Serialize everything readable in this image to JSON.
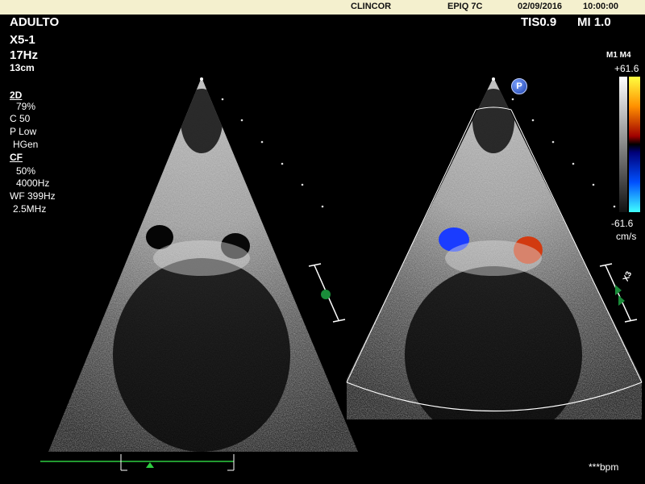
{
  "header": {
    "facility": "CLINCOR",
    "system": "EPIQ 7C",
    "date": "02/09/2016",
    "time": "10:00:00"
  },
  "exam": {
    "preset": "ADULTO",
    "probe": "X5-1",
    "frame_rate": "17Hz",
    "depth": "13cm",
    "tis": "TIS0.9",
    "mi": "MI 1.0"
  },
  "mode_2d": {
    "label": "2D",
    "gain": "79%",
    "compression": "C 50",
    "power": "P Low",
    "frequency": "HGen"
  },
  "mode_cf": {
    "label": "CF",
    "gain": "50%",
    "prf": "4000Hz",
    "wall_filter": "WF 399Hz",
    "frequency": "2.5MHz"
  },
  "color_scale": {
    "maps": "M1 M4",
    "max": "+61.6",
    "min": "-61.6",
    "unit": "cm/s"
  },
  "badges": {
    "p_marker": "P",
    "biplane": "X3"
  },
  "footer": {
    "heart_rate": "***bpm"
  },
  "icons": [
    "p-marker-icon",
    "x3-biplane-icon",
    "focus-marker-icon",
    "trigger-marker-icon"
  ],
  "colors": {
    "header_bg": "#f4f0ce",
    "ecg_line": "#2ecc40",
    "focus_marker": "#1a8c3a"
  }
}
